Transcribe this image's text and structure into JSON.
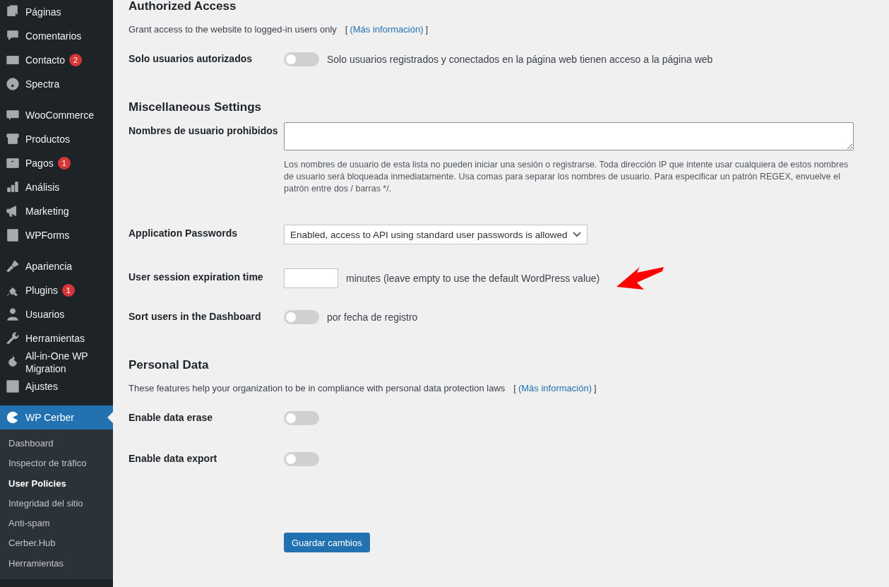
{
  "sidebar": {
    "groups": [
      [
        {
          "label": "Páginas"
        },
        {
          "label": "Comentarios"
        },
        {
          "label": "Contacto",
          "badge": "2"
        },
        {
          "label": "Spectra"
        }
      ],
      [
        {
          "label": "WooCommerce"
        },
        {
          "label": "Productos"
        },
        {
          "label": "Pagos",
          "badge": "1"
        },
        {
          "label": "Análisis"
        },
        {
          "label": "Marketing"
        },
        {
          "label": "WPForms"
        }
      ],
      [
        {
          "label": "Apariencia"
        },
        {
          "label": "Plugins",
          "badge": "1"
        },
        {
          "label": "Usuarios"
        },
        {
          "label": "Herramientas"
        },
        {
          "label": "All-in-One WP Migration"
        },
        {
          "label": "Ajustes"
        }
      ]
    ],
    "active": {
      "label": "WP Cerber"
    },
    "submenu": [
      {
        "label": "Dashboard",
        "selected": false
      },
      {
        "label": "Inspector de tráfico",
        "selected": false
      },
      {
        "label": "User Policies",
        "selected": true
      },
      {
        "label": "Integridad del sitio",
        "selected": false
      },
      {
        "label": "Anti-spam",
        "selected": false
      },
      {
        "label": "Cerber.Hub",
        "selected": false
      },
      {
        "label": "Herramientas",
        "selected": false
      }
    ]
  },
  "sections": [
    {
      "title": "Authorized Access",
      "description": "Grant access to the website to logged-in users only",
      "brackets": [
        "[",
        "]"
      ],
      "link": "(Más información)",
      "rows": [
        {
          "kind": "toggle",
          "label": "Solo usuarios autorizados",
          "on": false,
          "text": "Solo usuarios registrados y conectados en la página web tienen acceso a la página web"
        }
      ]
    },
    {
      "title": "Miscellaneous Settings",
      "rows": [
        {
          "kind": "textarea",
          "label": "Nombres de usuario prohibidos",
          "help": "Los nombres de usuario de esta lista no pueden iniciar una sesión o registrarse. Toda dirección IP que intente usar cualquiera de estos nombres de usuario será bloqueada inmediatamente. Usa comas para separar los nombres de usuario. Para especificar un patrón REGEX, envuelve el patrón entre dos / barras */."
        },
        {
          "kind": "select",
          "label": "Application Passwords",
          "value": "Enabled, access to API using standard user passwords is allowed"
        },
        {
          "kind": "number",
          "label": "User session expiration time",
          "text": "minutes (leave empty to use the default WordPress value)"
        },
        {
          "kind": "toggle",
          "label": "Sort users in the Dashboard",
          "on": false,
          "text": "por fecha de registro"
        }
      ]
    },
    {
      "title": "Personal Data",
      "description": "These features help your organization to be in compliance with personal data protection laws",
      "brackets": [
        "[",
        "]"
      ],
      "link": "(Más información)",
      "rows": [
        {
          "kind": "toggle",
          "label": "Enable data erase",
          "on": false
        },
        {
          "kind": "toggle",
          "label": "Enable data export",
          "on": false
        }
      ]
    }
  ],
  "save_button": "Guardar cambios"
}
